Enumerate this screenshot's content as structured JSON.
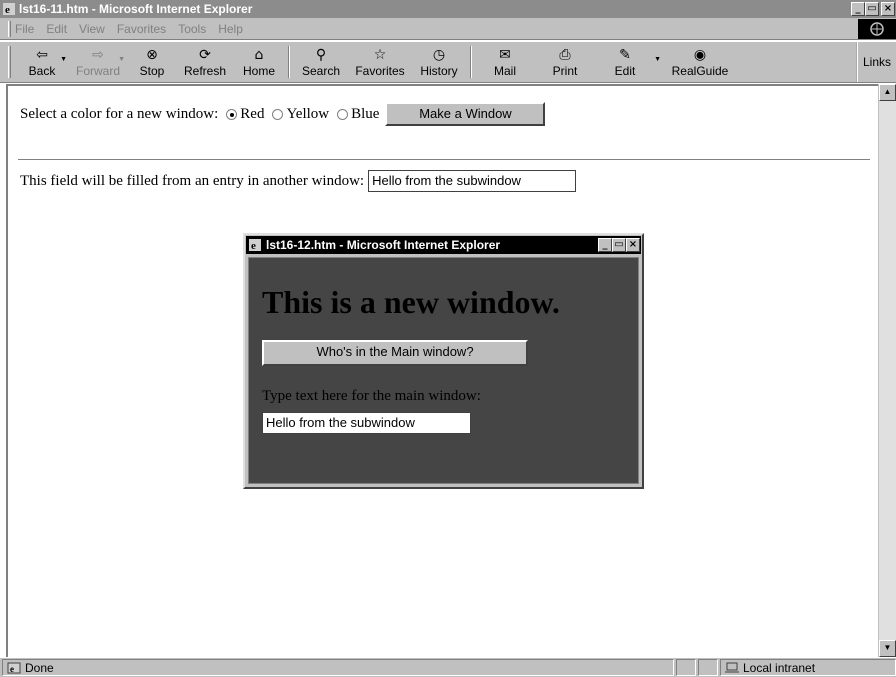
{
  "window": {
    "title": "lst16-11.htm - Microsoft Internet Explorer",
    "min_label": "_",
    "max_label": "□",
    "close_label": "×"
  },
  "menu": {
    "items": [
      {
        "label": "File",
        "key": "F"
      },
      {
        "label": "Edit",
        "key": "E"
      },
      {
        "label": "View",
        "key": "V"
      },
      {
        "label": "Favorites",
        "key": "a"
      },
      {
        "label": "Tools",
        "key": "T"
      },
      {
        "label": "Help",
        "key": "H"
      }
    ]
  },
  "toolbar": {
    "buttons": [
      {
        "label": "Back",
        "icon": "back-arrow-icon",
        "glyph": "⇦"
      },
      {
        "label": "Forward",
        "icon": "forward-arrow-icon",
        "glyph": "⇨"
      },
      {
        "label": "Stop",
        "icon": "stop-icon",
        "glyph": "⊗"
      },
      {
        "label": "Refresh",
        "icon": "refresh-icon",
        "glyph": "⟳"
      },
      {
        "label": "Home",
        "icon": "home-icon",
        "glyph": "⌂"
      },
      {
        "label": "Search",
        "icon": "search-icon",
        "glyph": "⚲"
      },
      {
        "label": "Favorites",
        "icon": "favorites-icon",
        "glyph": "☆"
      },
      {
        "label": "History",
        "icon": "history-icon",
        "glyph": "◷"
      },
      {
        "label": "Mail",
        "icon": "mail-icon",
        "glyph": "✉"
      },
      {
        "label": "Print",
        "icon": "print-icon",
        "glyph": "⎙"
      },
      {
        "label": "Edit",
        "icon": "edit-icon",
        "glyph": "✎"
      },
      {
        "label": "RealGuide",
        "icon": "realguide-icon",
        "glyph": "◉"
      }
    ],
    "links_label": "Links"
  },
  "page": {
    "color_prompt": "Select a color for a new window:",
    "colors": [
      "Red",
      "Yellow",
      "Blue"
    ],
    "selected_color": "Red",
    "make_window_label": "Make a Window",
    "field_prompt": "This field will be filled from an entry in another window:",
    "field_value": "Hello from the subwindow"
  },
  "subwindow": {
    "title": "lst16-12.htm - Microsoft Internet Explorer",
    "heading": "This is a new window.",
    "who_button_label": "Who's in the Main window?",
    "type_prompt": "Type text here for the main window:",
    "field_value": "Hello from the subwindow",
    "background_color": "#454545"
  },
  "statusbar": {
    "status_text": "Done",
    "zone_text": "Local intranet"
  }
}
